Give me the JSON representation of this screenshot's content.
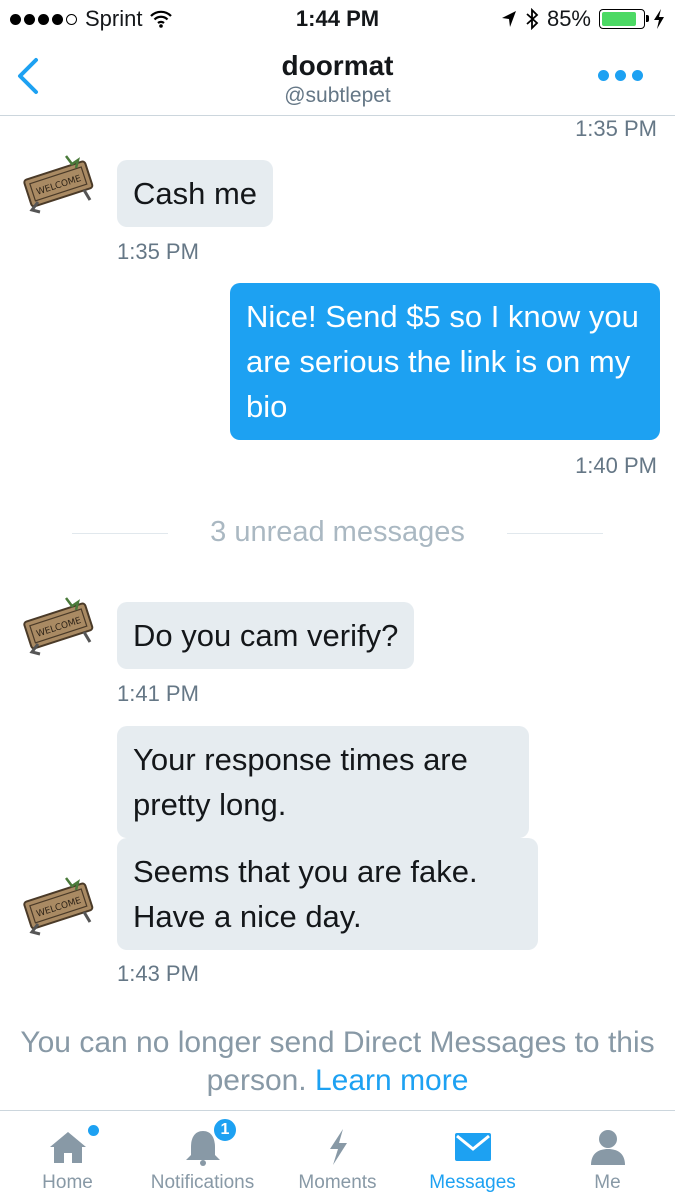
{
  "status_bar": {
    "carrier": "Sprint",
    "time": "1:44 PM",
    "battery": "85%"
  },
  "header": {
    "title": "doormat",
    "handle": "@subtlepet"
  },
  "messages": [
    {
      "time": "1:35 PM"
    },
    {
      "text": "Cash me",
      "time": "1:35 PM"
    },
    {
      "text": "Nice! Send $5 so I know you are serious the link is on my bio",
      "time": "1:40 PM"
    },
    {
      "text": "Do you cam verify?",
      "time": "1:41 PM"
    },
    {
      "text": "Your response times are pretty long."
    },
    {
      "text": "Seems that you are fake. Have a nice day.",
      "time": "1:43 PM"
    }
  ],
  "unread_label": "3 unread messages",
  "notice": {
    "text": "You can no longer send Direct Messages to this person.",
    "link": "Learn more"
  },
  "tabs": [
    {
      "label": "Home"
    },
    {
      "label": "Notifications",
      "badge": "1"
    },
    {
      "label": "Moments"
    },
    {
      "label": "Messages",
      "active": true
    },
    {
      "label": "Me"
    }
  ],
  "colors": {
    "accent": "#1da1f2",
    "incoming_bubble": "#e6ecf0",
    "muted": "#657786"
  },
  "icons": [
    "back-chevron-icon",
    "more-dots-icon",
    "doormat-avatar-icon",
    "home-icon",
    "bell-icon",
    "lightning-icon",
    "envelope-icon",
    "person-icon"
  ]
}
